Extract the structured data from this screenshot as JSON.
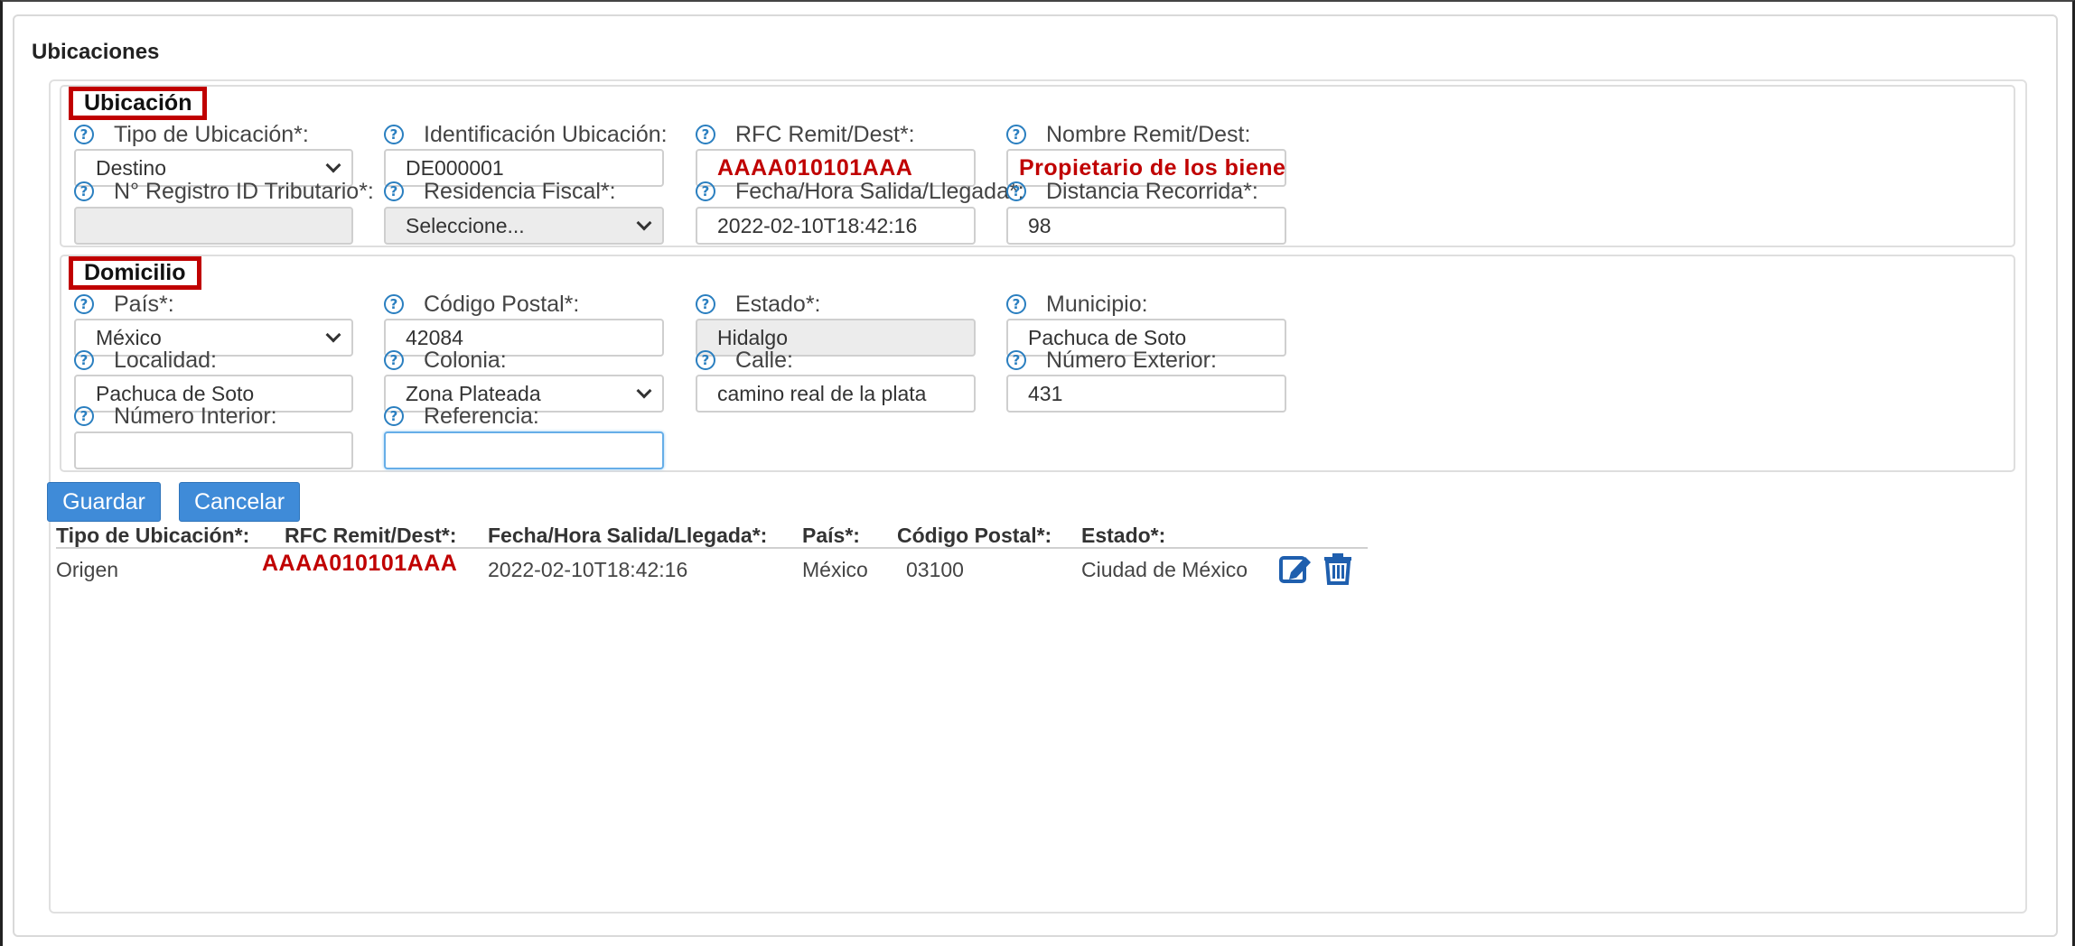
{
  "panel": {
    "title": "Ubicaciones"
  },
  "ubicacion": {
    "legend": "Ubicación",
    "tipo_label": "Tipo de Ubicación*:",
    "tipo_value": "Destino",
    "ident_label": "Identificación Ubicación:",
    "ident_value": "DE000001",
    "rfc_label": "RFC Remit/Dest*:",
    "rfc_value": "AAAA010101AAA",
    "nombre_label": "Nombre Remit/Dest:",
    "nombre_value": "Propietario de los bienes",
    "registro_label": "N° Registro ID Tributario*:",
    "registro_value": "",
    "residencia_label": "Residencia Fiscal*:",
    "residencia_value": "Seleccione...",
    "fecha_label": "Fecha/Hora Salida/Llegada*:",
    "fecha_value": "2022-02-10T18:42:16",
    "distancia_label": "Distancia Recorrida*:",
    "distancia_value": "98"
  },
  "domicilio": {
    "legend": "Domicilio",
    "pais_label": "País*:",
    "pais_value": "México",
    "cp_label": "Código Postal*:",
    "cp_value": "42084",
    "estado_label": "Estado*:",
    "estado_value": "Hidalgo",
    "municipio_label": "Municipio:",
    "municipio_value": "Pachuca de Soto",
    "localidad_label": "Localidad:",
    "localidad_value": "Pachuca de Soto",
    "colonia_label": "Colonia:",
    "colonia_value": "Zona Plateada",
    "calle_label": "Calle:",
    "calle_value": "camino real de la plata",
    "numext_label": "Número Exterior:",
    "numext_value": "431",
    "numint_label": "Número Interior:",
    "numint_value": "",
    "referencia_label": "Referencia:",
    "referencia_value": ""
  },
  "buttons": {
    "guardar": "Guardar",
    "cancelar": "Cancelar"
  },
  "table": {
    "headers": [
      "Tipo de Ubicación*:",
      "RFC Remit/Dest*:",
      "Fecha/Hora Salida/Llegada*:",
      "País*:",
      "Código Postal*:",
      "Estado*:"
    ],
    "rows": [
      [
        "Origen",
        "AAAA010101AAA",
        "2022-02-10T18:42:16",
        "México",
        "03100",
        "Ciudad de México"
      ]
    ]
  },
  "icons": {
    "help": "?",
    "edit": "edit-icon",
    "delete": "trash-icon"
  },
  "colors": {
    "accent": "#3f8bd8",
    "highlight": "#c00000",
    "help": "#2a7fc0"
  }
}
